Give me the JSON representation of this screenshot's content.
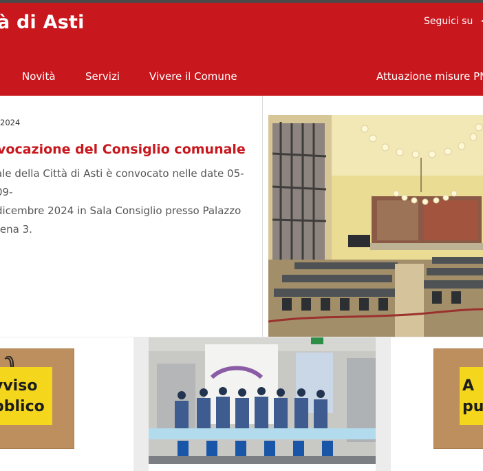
{
  "header": {
    "title": "à di Asti",
    "social_label": "Seguici su",
    "social_icon": "social-icon"
  },
  "nav": {
    "items": [
      "Novità",
      "Servizi",
      "Vivere il Comune",
      "Attuazione misure PN"
    ]
  },
  "news": {
    "date": "2024",
    "title": "vocazione del Consiglio comunale",
    "lines": [
      "ale della Città di Asti è convocato nelle date 05-09-",
      "dicembre 2024 in Sala Consiglio presso Palazzo",
      "tena 3."
    ]
  },
  "cards": {
    "left_note": [
      "vviso",
      "bblico"
    ],
    "right_note": [
      "A",
      "pu"
    ]
  },
  "colors": {
    "brand": "#c8171d",
    "note_yellow": "#f4d71d",
    "cork": "#bd8f5e"
  }
}
